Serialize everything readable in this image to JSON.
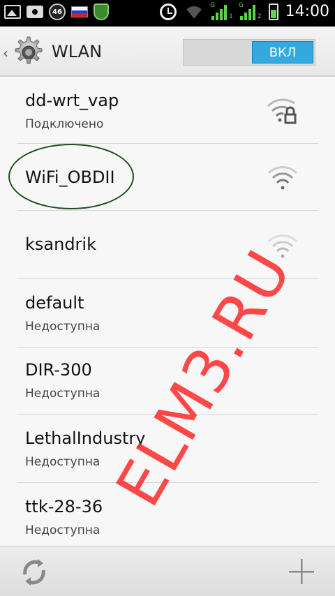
{
  "statusbar": {
    "badge": "46",
    "time": "14:00",
    "sim1_label": "G",
    "sim1_num": "1",
    "sim2_label": "G",
    "sim2_num": "2"
  },
  "actionbar": {
    "title": "WLAN",
    "switch_label": "ВКЛ",
    "back_icon": "chevron-left-icon",
    "settings_icon": "gear-icon"
  },
  "networks": [
    {
      "ssid": "dd-wrt_vap",
      "status": "Подключено",
      "secured": true,
      "signal": "strong"
    },
    {
      "ssid": "WiFi_OBDII",
      "status": "",
      "secured": false,
      "signal": "strong"
    },
    {
      "ssid": "ksandrik",
      "status": "",
      "secured": false,
      "signal": "weak"
    },
    {
      "ssid": "default",
      "status": "Недоступна",
      "secured": false,
      "signal": "none"
    },
    {
      "ssid": "DIR-300",
      "status": "Недоступна",
      "secured": false,
      "signal": "none"
    },
    {
      "ssid": "LethalIndustry",
      "status": "Недоступна",
      "secured": false,
      "signal": "none"
    },
    {
      "ssid": "ttk-28-36",
      "status": "Недоступна",
      "secured": false,
      "signal": "none"
    }
  ],
  "watermark": "ELM3.RU",
  "bottombar": {
    "refresh_icon": "refresh-icon",
    "add_icon": "add-icon"
  },
  "colors": {
    "accent": "#33a9e0",
    "watermark": "#ff2828",
    "highlight_oval": "#1d4d1d"
  }
}
